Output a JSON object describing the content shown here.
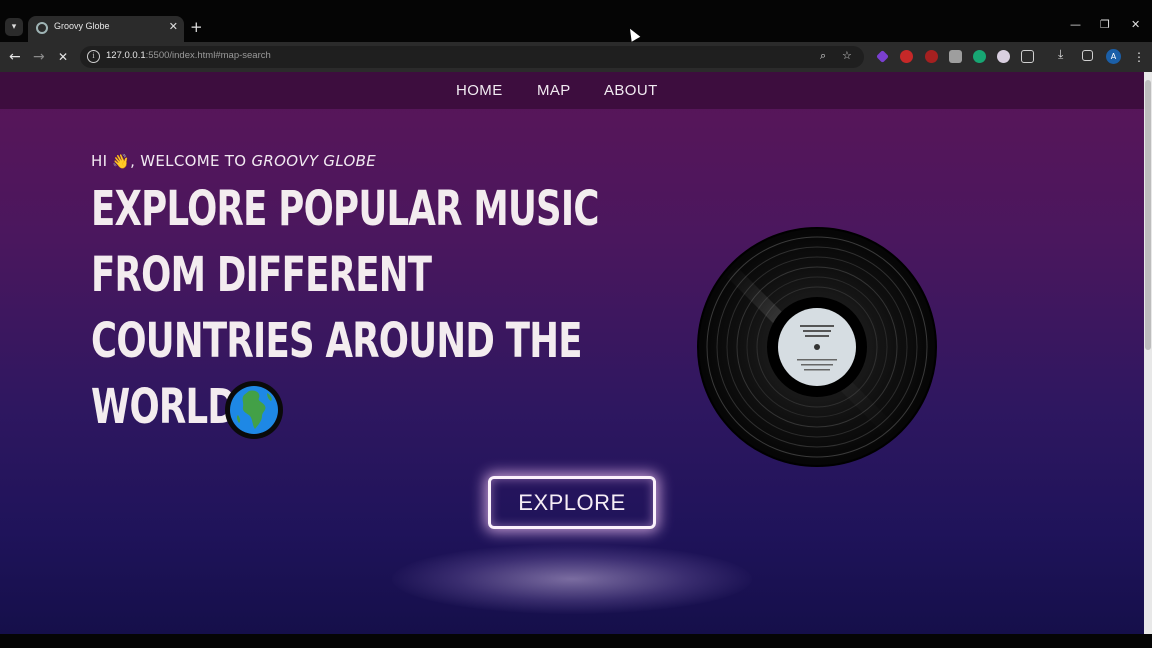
{
  "browser": {
    "tab_title": "Groovy Globe",
    "url_host": "127.0.0.1",
    "url_rest": ":5500/index.html#map-search",
    "new_tab_label": "+",
    "tab_close_label": "✕"
  },
  "nav": {
    "items": [
      {
        "label": "HOME"
      },
      {
        "label": "MAP"
      },
      {
        "label": "ABOUT"
      }
    ]
  },
  "hero": {
    "greeting_prefix": "HI",
    "wave_emoji": "👋",
    "greeting_mid": ", WELCOME TO",
    "brand": "GROOVY GLOBE",
    "headline_lines": [
      "EXPLORE POPULAR MUSIC",
      "FROM DIFFERENT",
      "COUNTRIES AROUND THE",
      "WORLD"
    ],
    "globe_icon": "globe-africa-icon",
    "record_icon": "vinyl-record-icon",
    "explore_label": "EXPLORE"
  },
  "colors": {
    "nav_bg": "#3d0d3e",
    "gradient_top": "#5a1558",
    "gradient_bottom": "#150f4a",
    "button_glow": "#fbf1fb"
  }
}
